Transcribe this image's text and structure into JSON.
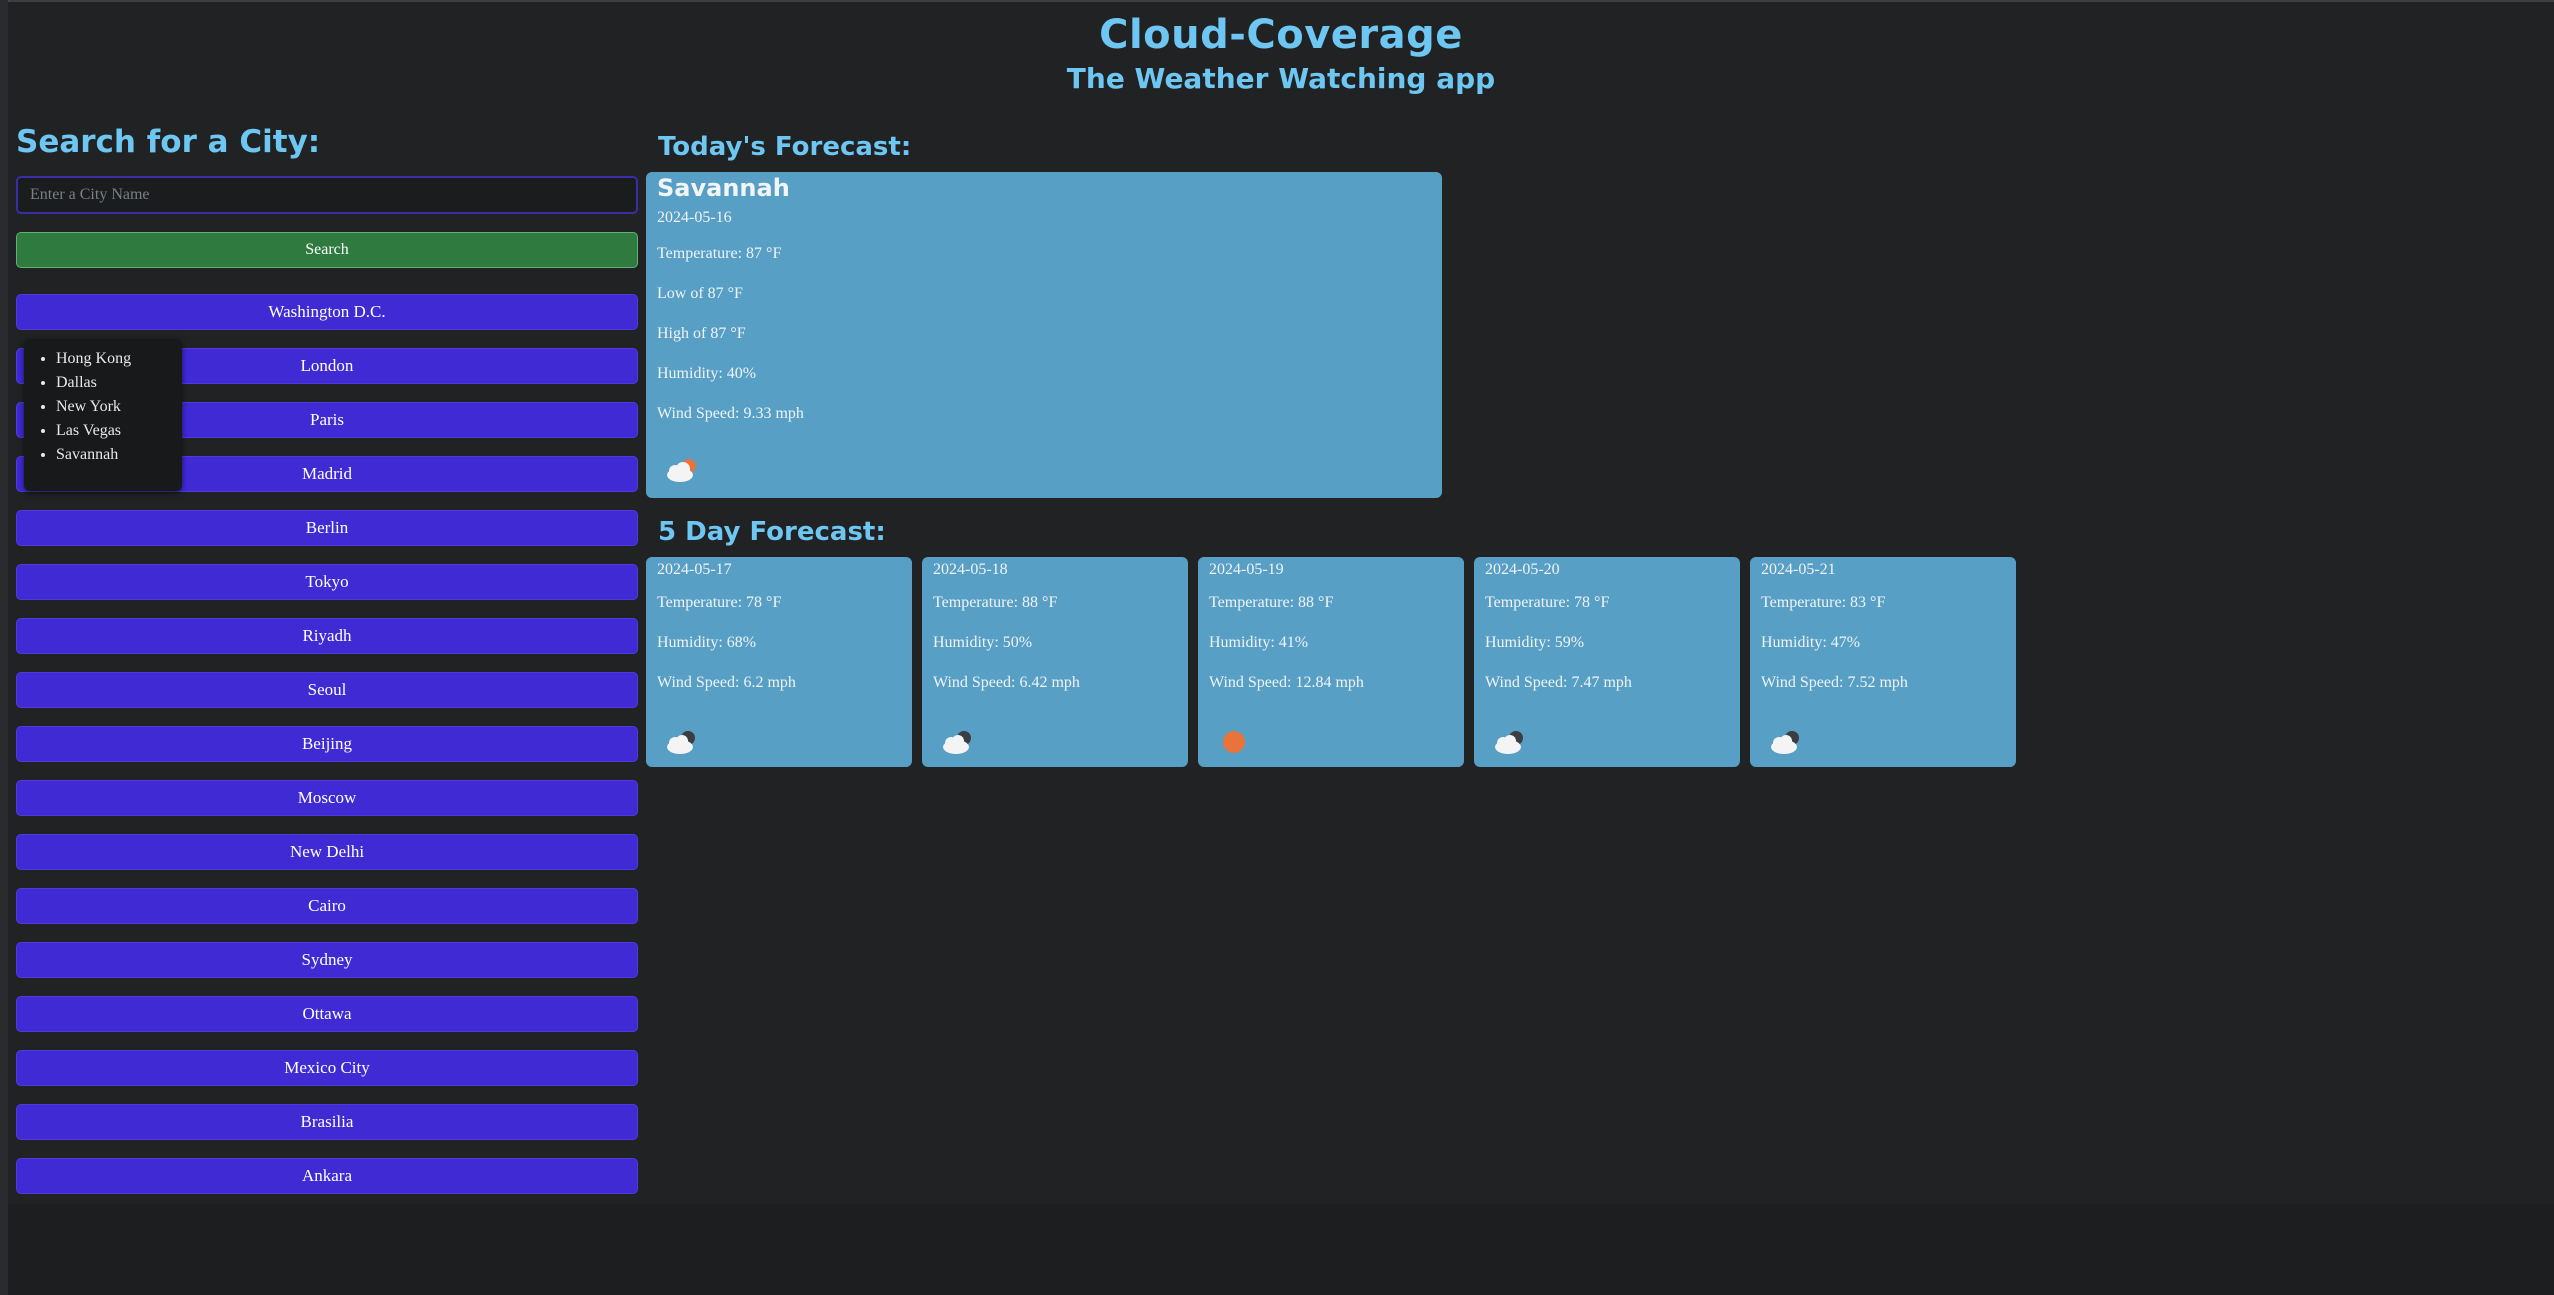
{
  "header": {
    "title": "Cloud-Coverage",
    "subtitle": "The Weather Watching app"
  },
  "search": {
    "heading": "Search for a City:",
    "placeholder": "Enter a City Name",
    "value": "",
    "button_label": "Search",
    "history": [
      "Hong Kong",
      "Dallas",
      "New York",
      "Las Vegas",
      "Savannah"
    ]
  },
  "cities": [
    "Washington D.C.",
    "London",
    "Paris",
    "Madrid",
    "Berlin",
    "Tokyo",
    "Riyadh",
    "Seoul",
    "Beijing",
    "Moscow",
    "New Delhi",
    "Cairo",
    "Sydney",
    "Ottawa",
    "Mexico City",
    "Brasilia",
    "Ankara"
  ],
  "today": {
    "heading": "Today's Forecast:",
    "city": "Savannah",
    "date": "2024-05-16",
    "temperature": "Temperature: 87 °F",
    "low": "Low of 87 °F",
    "high": "High of 87 °F",
    "humidity": "Humidity: 40%",
    "wind": "Wind Speed: 9.33 mph",
    "icon": "cloud-sun-icon"
  },
  "forecast": {
    "heading": "5 Day Forecast:",
    "days": [
      {
        "date": "2024-05-17",
        "temperature": "Temperature: 78 °F",
        "humidity": "Humidity: 68%",
        "wind": "Wind Speed: 6.2 mph",
        "icon": "cloud-moon-icon"
      },
      {
        "date": "2024-05-18",
        "temperature": "Temperature: 88 °F",
        "humidity": "Humidity: 50%",
        "wind": "Wind Speed: 6.42 mph",
        "icon": "cloud-moon-icon"
      },
      {
        "date": "2024-05-19",
        "temperature": "Temperature: 88 °F",
        "humidity": "Humidity: 41%",
        "wind": "Wind Speed: 12.84 mph",
        "icon": "sun-icon"
      },
      {
        "date": "2024-05-20",
        "temperature": "Temperature: 78 °F",
        "humidity": "Humidity: 59%",
        "wind": "Wind Speed: 7.47 mph",
        "icon": "cloud-moon-icon"
      },
      {
        "date": "2024-05-21",
        "temperature": "Temperature: 83 °F",
        "humidity": "Humidity: 47%",
        "wind": "Wind Speed: 7.52 mph",
        "icon": "cloud-moon-icon"
      }
    ]
  },
  "colors": {
    "accent": "#6ec6f2",
    "card": "#579fc5",
    "city_button": "#3f2ad4",
    "search_button": "#2f7a3e",
    "background": "#212224"
  }
}
